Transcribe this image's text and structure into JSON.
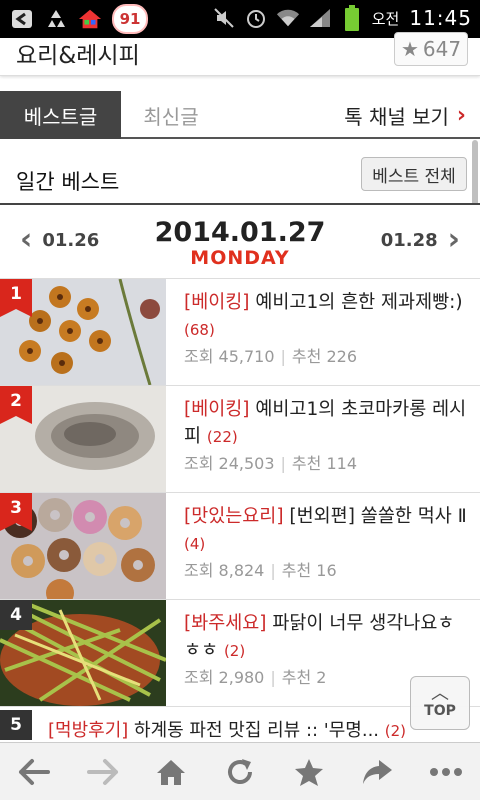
{
  "status": {
    "ampm": "오전",
    "time": "11:45",
    "badge": "91"
  },
  "header": {
    "title": "요리&레시피",
    "fav_count": "647"
  },
  "tabs": {
    "best": "베스트글",
    "recent": "최신글",
    "channel": "톡 채널 보기"
  },
  "daily": {
    "title": "일간 베스트",
    "best_all": "베스트 전체"
  },
  "datenav": {
    "prev": "01.26",
    "current": "2014.01.27",
    "day": "MONDAY",
    "next": "01.28"
  },
  "items": [
    {
      "rank": "1",
      "category": "[베이킹]",
      "title": " 예비고1의 흔한 제과제빵:)",
      "count": "(68)",
      "views_label": "조회",
      "views": "45,710",
      "rec_label": "추천",
      "rec": "226"
    },
    {
      "rank": "2",
      "category": "[베이킹]",
      "title": " 예비고1의 초코마카롱 레시피",
      "count": "(22)",
      "views_label": "조회",
      "views": "24,503",
      "rec_label": "추천",
      "rec": "114"
    },
    {
      "rank": "3",
      "category": "[맛있는요리]",
      "title": " [번외편] 쏠쏠한 먹사 Ⅱ",
      "count": "(4)",
      "views_label": "조회",
      "views": "8,824",
      "rec_label": "추천",
      "rec": "16"
    },
    {
      "rank": "4",
      "category": "[봐주세요]",
      "title": " 파닭이 너무 생각나요ㅎㅎㅎ",
      "count": "(2)",
      "views_label": "조회",
      "views": "2,980",
      "rec_label": "추천",
      "rec": "2"
    }
  ],
  "item5": {
    "rank": "5",
    "category": "[먹방후기]",
    "title": " 하계동 파전 맛집 리뷰 :: '무명...",
    "count": "(2)"
  },
  "top_button": "TOP",
  "colors": {
    "accent_red": "#cc2a2a",
    "tab_active": "#444444",
    "day_red": "#e0301e"
  }
}
